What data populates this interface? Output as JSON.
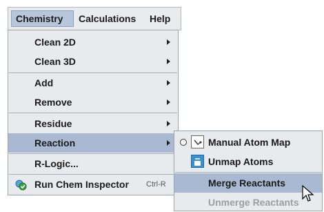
{
  "menubar": {
    "chemistry": "Chemistry",
    "calculations": "Calculations",
    "help": "Help"
  },
  "menu": {
    "clean2d": "Clean 2D",
    "clean3d": "Clean 3D",
    "add": "Add",
    "remove": "Remove",
    "residue": "Residue",
    "reaction": "Reaction",
    "rlogic": "R-Logic...",
    "run_inspector": "Run Chem Inspector",
    "run_inspector_shortcut": "Ctrl-R"
  },
  "submenu": {
    "manual_map": "Manual Atom Map",
    "unmap": "Unmap Atoms",
    "merge": "Merge Reactants",
    "unmerge": "Unmerge Reactants"
  },
  "colors": {
    "highlight": "#a9b9d1",
    "menu_bg": "#e8ebee",
    "disabled_text": "#9a9ea3"
  },
  "icons": {
    "submenu_arrow": "triangle-right-icon",
    "inspector": "chem-inspector-icon",
    "manual_map": "atom-map-icon",
    "unmap": "unmap-atoms-icon",
    "radio": "radio-button-icon",
    "cursor": "mouse-pointer-icon"
  }
}
